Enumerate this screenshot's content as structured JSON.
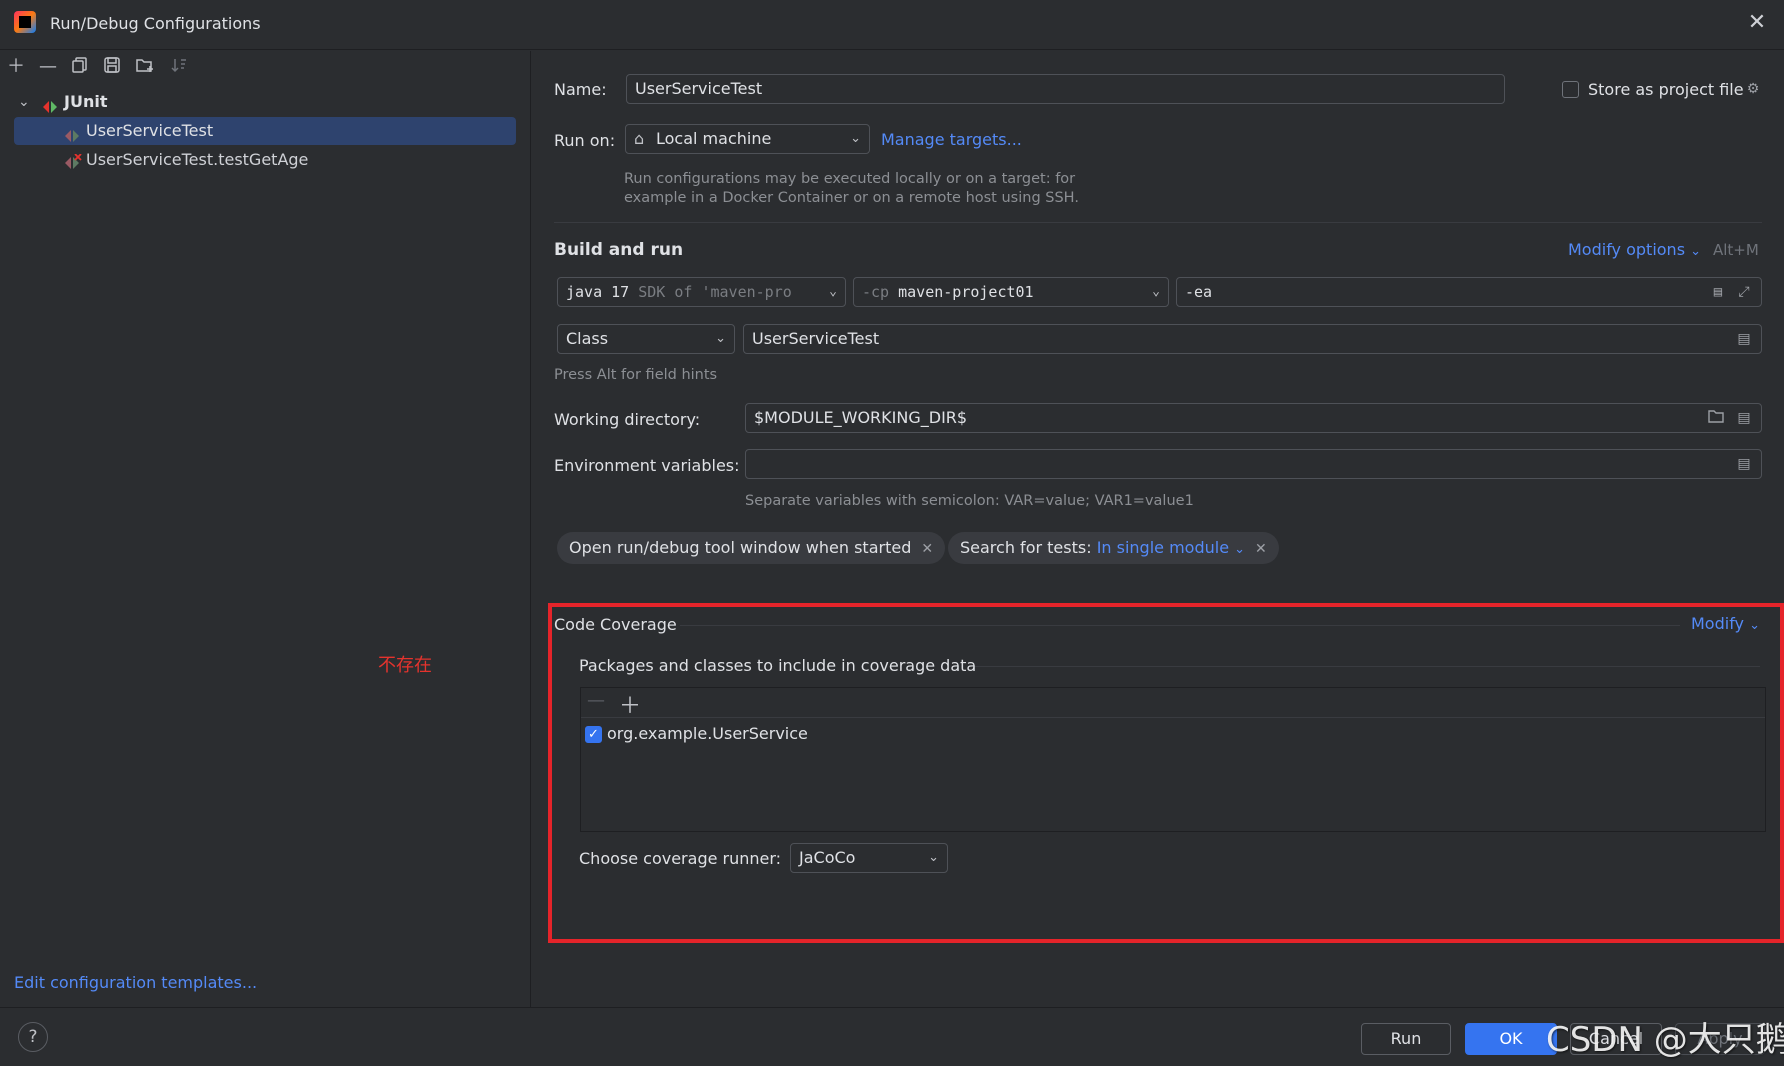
{
  "window": {
    "title": "Run/Debug Configurations"
  },
  "left_toolbar": {
    "icons": [
      "add-icon",
      "remove-icon",
      "copy-icon",
      "save-icon",
      "new-folder-icon",
      "sort-icon"
    ]
  },
  "tree": {
    "group_label": "JUnit",
    "items": [
      {
        "label": "UserServiceTest",
        "selected": true
      },
      {
        "label": "UserServiceTest.testGetAge",
        "selected": false,
        "error": true
      }
    ]
  },
  "annotation": {
    "note": "不存在"
  },
  "edit_templates_link": "Edit configuration templates...",
  "form": {
    "name_label": "Name:",
    "name_value": "UserServiceTest",
    "store_label": "Store as project file",
    "run_on_label": "Run on:",
    "run_on_value": "Local machine",
    "manage_targets": "Manage targets...",
    "run_on_hint_line1": "Run configurations may be executed locally or on a target: for",
    "run_on_hint_line2": "example in a Docker Container or on a remote host using SSH.",
    "build_run_title": "Build and run",
    "modify_options": "Modify options",
    "modify_shortcut": "Alt+M",
    "jre_main": "java 17",
    "jre_dim": "SDK of 'maven-pro",
    "cp_dim": "-cp",
    "cp_value": "maven-project01",
    "vm_options": "-ea",
    "test_kind": "Class",
    "class_value": "UserServiceTest",
    "field_hints": "Press Alt for field hints",
    "working_dir_label": "Working directory:",
    "working_dir_value": "$MODULE_WORKING_DIR$",
    "env_label": "Environment variables:",
    "env_value": "",
    "env_hint": "Separate variables with semicolon: VAR=value; VAR1=value1",
    "chip1": "Open run/debug tool window when started",
    "chip2_prefix": "Search for tests:",
    "chip2_value": "In single module"
  },
  "coverage": {
    "title": "Code Coverage",
    "modify": "Modify",
    "packages_label": "Packages and classes to include in coverage data",
    "entries": [
      {
        "label": "org.example.UserService",
        "checked": true
      }
    ],
    "runner_label": "Choose coverage runner:",
    "runner_value": "JaCoCo"
  },
  "buttons": {
    "run": "Run",
    "ok": "OK",
    "cancel": "Cancel",
    "apply": "Apply"
  },
  "watermark": "CSDN @大只鹅",
  "colors": {
    "accent": "#3574f0",
    "link": "#548af7",
    "highlight_box": "#e5242a",
    "selection": "#2e436e"
  }
}
